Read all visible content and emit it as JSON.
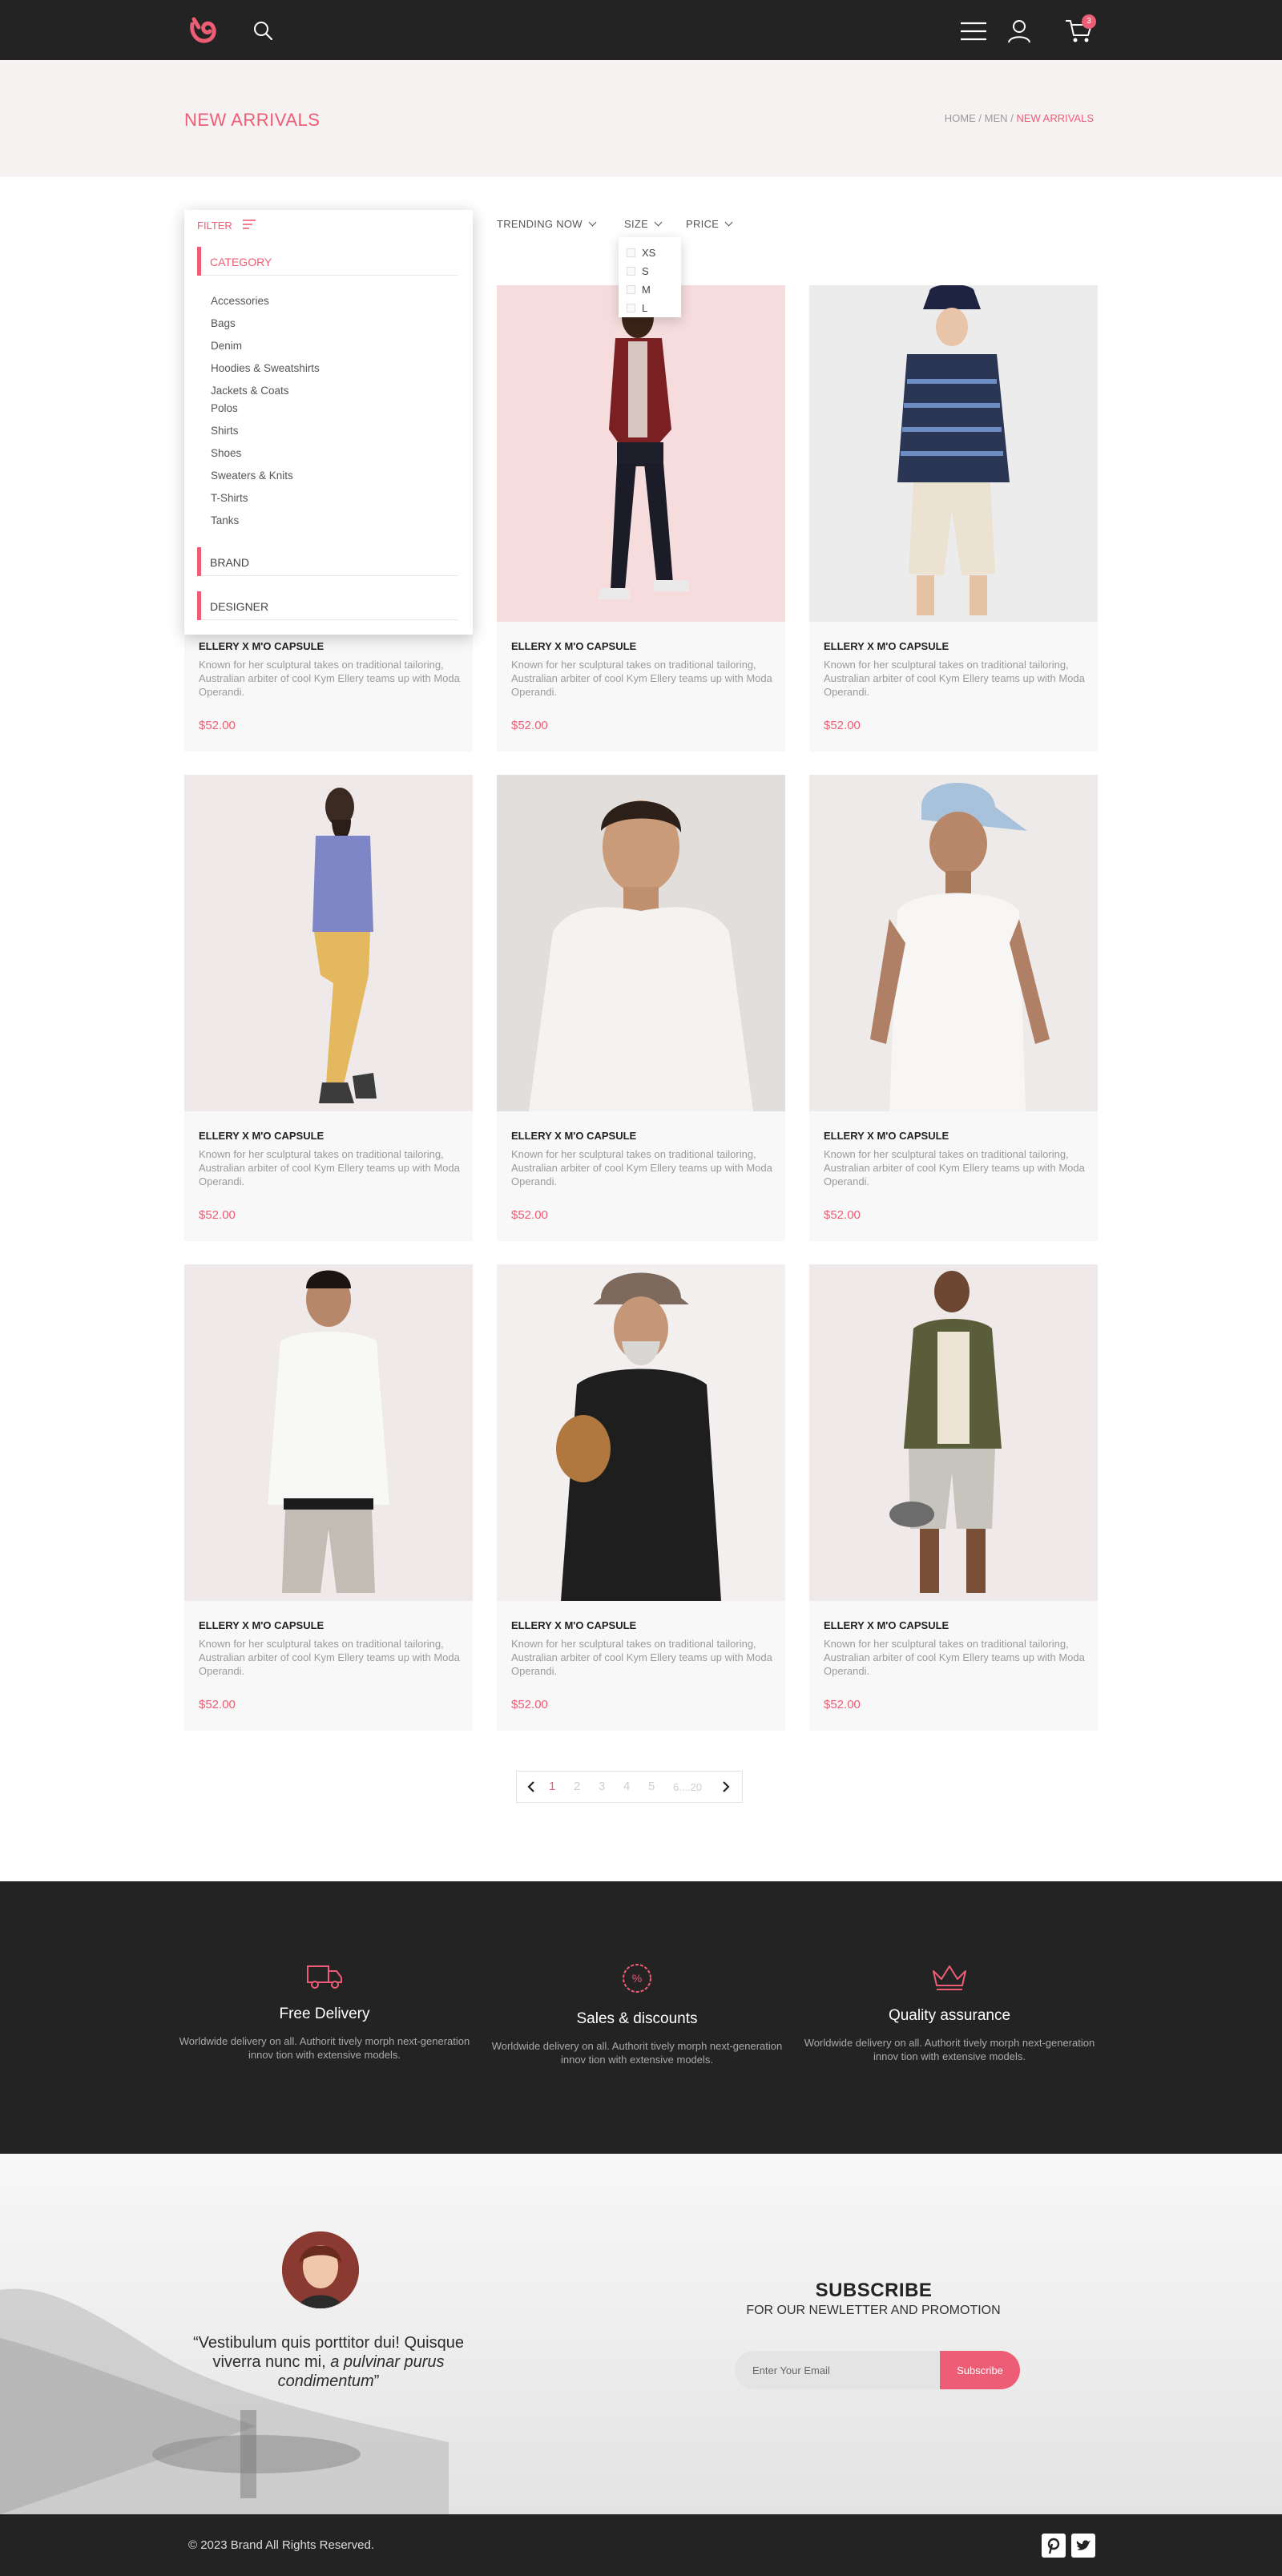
{
  "header": {
    "cart_count": "3"
  },
  "hero": {
    "title": "NEW ARRIVALS",
    "crumb_home": "HOME",
    "crumb_sep1": "/",
    "crumb_men": "MEN",
    "crumb_sep2": "/",
    "crumb_current": "NEW ARRIVALS"
  },
  "filters": {
    "filter_label": "FILTER",
    "trending_label": "TRENDING NOW",
    "size_label": "SIZE",
    "price_label": "PRICE",
    "sizes": [
      "XS",
      "S",
      "M",
      "L"
    ]
  },
  "filter_panel": {
    "category_label": "CATEGORY",
    "categories": [
      "Accessories",
      "Bags",
      "Denim",
      "Hoodies & Sweatshirts",
      "Jackets & Coats",
      "Polos",
      "Shirts",
      "Shoes",
      "Sweaters & Knits",
      "T-Shirts",
      "Tanks"
    ],
    "brand_label": "BRAND",
    "designer_label": "DESIGNER"
  },
  "products": [
    {
      "name": "ELLERY X M'O CAPSULE",
      "desc": "Known for her sculptural takes on traditional tailoring, Australian arbiter of cool Kym Ellery teams up with Moda Operandi.",
      "price": "$52.00"
    },
    {
      "name": "ELLERY X M'O CAPSULE",
      "desc": "Known for her sculptural takes on traditional tailoring, Australian arbiter of cool Kym Ellery teams up with Moda Operandi.",
      "price": "$52.00"
    },
    {
      "name": "ELLERY X M'O CAPSULE",
      "desc": "Known for her sculptural takes on traditional tailoring, Australian arbiter of cool Kym Ellery teams up with Moda Operandi.",
      "price": "$52.00"
    },
    {
      "name": "ELLERY X M'O CAPSULE",
      "desc": "Known for her sculptural takes on traditional tailoring, Australian arbiter of cool Kym Ellery teams up with Moda Operandi.",
      "price": "$52.00"
    },
    {
      "name": "ELLERY X M'O CAPSULE",
      "desc": "Known for her sculptural takes on traditional tailoring, Australian arbiter of cool Kym Ellery teams up with Moda Operandi.",
      "price": "$52.00"
    },
    {
      "name": "ELLERY X M'O CAPSULE",
      "desc": "Known for her sculptural takes on traditional tailoring, Australian arbiter of cool Kym Ellery teams up with Moda Operandi.",
      "price": "$52.00"
    },
    {
      "name": "ELLERY X M'O CAPSULE",
      "desc": "Known for her sculptural takes on traditional tailoring, Australian arbiter of cool Kym Ellery teams up with Moda Operandi.",
      "price": "$52.00"
    },
    {
      "name": "ELLERY X M'O CAPSULE",
      "desc": "Known for her sculptural takes on traditional tailoring, Australian arbiter of cool Kym Ellery teams up with Moda Operandi.",
      "price": "$52.00"
    },
    {
      "name": "ELLERY X M'O CAPSULE",
      "desc": "Known for her sculptural takes on traditional tailoring, Australian arbiter of cool Kym Ellery teams up with Moda Operandi.",
      "price": "$52.00"
    }
  ],
  "pagination": {
    "pages": [
      "1",
      "2",
      "3",
      "4",
      "5",
      "6....20"
    ],
    "current": "1"
  },
  "features": [
    {
      "icon": "delivery-truck-icon",
      "title": "Free Delivery",
      "text": "Worldwide delivery on all. Authorit tively morph next-generation innov tion with extensive models."
    },
    {
      "icon": "discount-badge-icon",
      "title": "Sales & discounts",
      "text": "Worldwide delivery on all. Authorit tively morph next-generation innov tion with extensive models."
    },
    {
      "icon": "crown-icon",
      "title": "Quality assurance",
      "text": "Worldwide delivery on all. Authorit tively morph next-generation innov tion with extensive models."
    }
  ],
  "testimonial": {
    "quote_start": "“Vestibulum quis porttitor dui! Quisque viverra nunc mi, ",
    "quote_em": "a pulvinar purus condimentum",
    "quote_end": "”"
  },
  "subscribe": {
    "title": "SUBSCRIBE",
    "subtitle": "FOR OUR NEWLETTER AND PROMOTION",
    "placeholder": "Enter Your Email",
    "button": "Subscribe"
  },
  "footer": {
    "copyright": "© 2023  Brand  All Rights Reserved."
  },
  "colors": {
    "accent": "#ed5d75",
    "dark": "#232323"
  }
}
